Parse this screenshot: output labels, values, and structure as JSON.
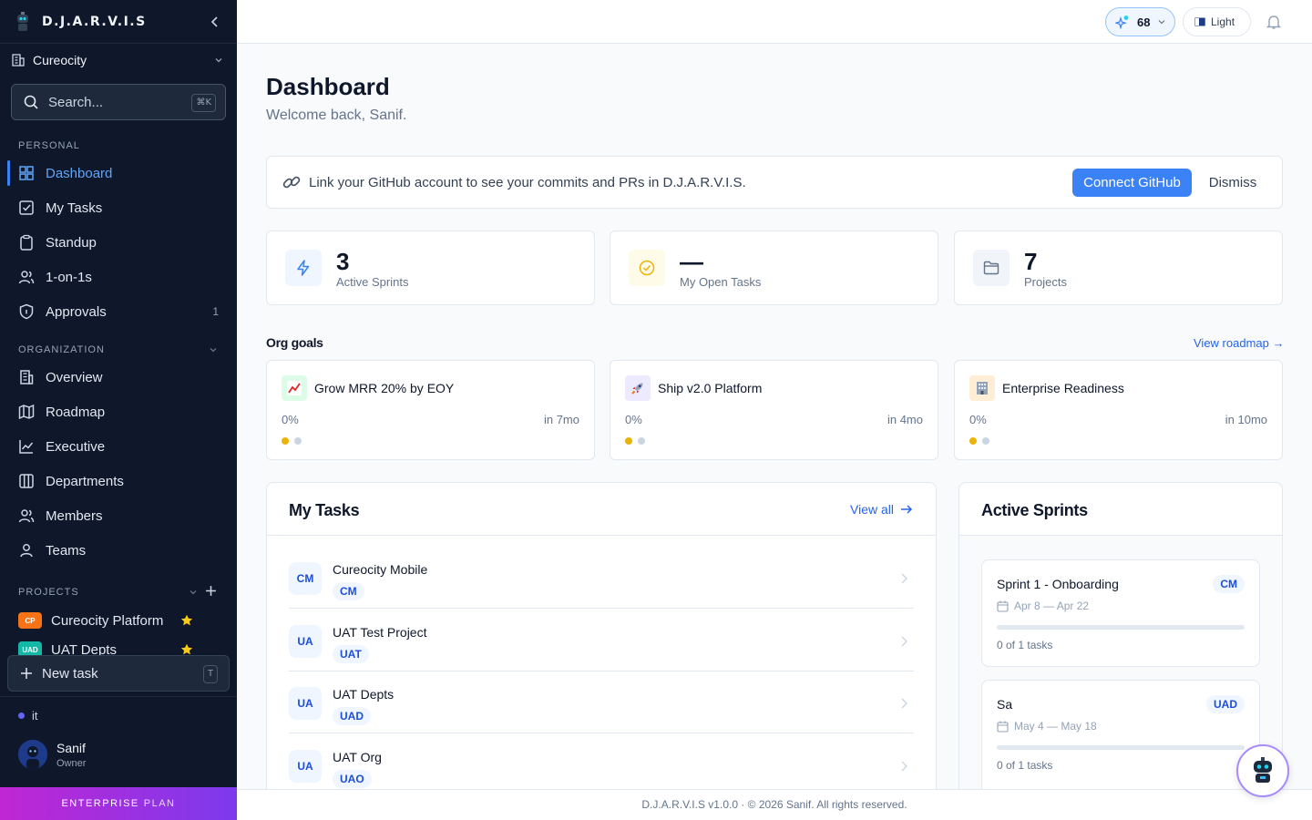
{
  "brand": {
    "name": "D.J.A.R.V.I.S"
  },
  "org": {
    "name": "Cureocity"
  },
  "search": {
    "placeholder": "Search...",
    "shortcut": "⌘K"
  },
  "sidebar": {
    "personal_label": "PERSONAL",
    "personal": [
      {
        "label": "Dashboard",
        "icon": "grid-icon",
        "active": true
      },
      {
        "label": "My Tasks",
        "icon": "checkbox-icon"
      },
      {
        "label": "Standup",
        "icon": "clipboard-icon"
      },
      {
        "label": "1-on-1s",
        "icon": "users-icon"
      },
      {
        "label": "Approvals",
        "icon": "shield-icon",
        "count": "1"
      }
    ],
    "organization_label": "ORGANIZATION",
    "organization": [
      {
        "label": "Overview",
        "icon": "building-icon"
      },
      {
        "label": "Roadmap",
        "icon": "map-icon"
      },
      {
        "label": "Executive",
        "icon": "line-chart-icon"
      },
      {
        "label": "Departments",
        "icon": "columns-icon"
      },
      {
        "label": "Members",
        "icon": "users-icon"
      },
      {
        "label": "Teams",
        "icon": "team-icon"
      }
    ],
    "projects_label": "PROJECTS",
    "projects": [
      {
        "badge": "CP",
        "label": "Cureocity Platform",
        "color": "#f97316"
      },
      {
        "badge": "UAD",
        "label": "UAT Depts",
        "color": "#14b8a6"
      }
    ],
    "new_task": {
      "label": "New task",
      "shortcut": "T"
    },
    "workspace": "it",
    "user": {
      "name": "Sanif",
      "role": "Owner"
    },
    "plan": {
      "word1": "ENTERPRISE",
      "word2": "PLAN"
    }
  },
  "topbar": {
    "ai_count": "68",
    "theme_label": "Light"
  },
  "header": {
    "title": "Dashboard",
    "subtitle": "Welcome back, Sanif."
  },
  "banner": {
    "text": "Link your GitHub account to see your commits and PRs in D.J.A.R.V.I.S.",
    "connect_label": "Connect GitHub",
    "dismiss_label": "Dismiss"
  },
  "stats": [
    {
      "value": "3",
      "label": "Active Sprints",
      "icon": "lightning-icon"
    },
    {
      "value": "—",
      "label": "My Open Tasks",
      "icon": "check-circle-icon"
    },
    {
      "value": "7",
      "label": "Projects",
      "icon": "folder-icon"
    }
  ],
  "goals": {
    "heading": "Org goals",
    "link": "View roadmap →",
    "items": [
      {
        "title": "Grow MRR 20% by EOY",
        "progress": "0%",
        "due": "in 7mo",
        "icon": "chart-up-icon"
      },
      {
        "title": "Ship v2.0 Platform",
        "progress": "0%",
        "due": "in 4mo",
        "icon": "rocket-icon"
      },
      {
        "title": "Enterprise Readiness",
        "progress": "0%",
        "due": "in 10mo",
        "icon": "office-building-icon"
      }
    ]
  },
  "my_tasks": {
    "title": "My Tasks",
    "view_all": "View all",
    "items": [
      {
        "avatar": "CM",
        "name": "Cureocity Mobile",
        "tag": "CM"
      },
      {
        "avatar": "UA",
        "name": "UAT Test Project",
        "tag": "UAT"
      },
      {
        "avatar": "UA",
        "name": "UAT Depts",
        "tag": "UAD"
      },
      {
        "avatar": "UA",
        "name": "UAT Org",
        "tag": "UAO"
      }
    ]
  },
  "active_sprints": {
    "title": "Active Sprints",
    "items": [
      {
        "name": "Sprint 1 - Onboarding",
        "tag": "CM",
        "dates": "Apr 8 — Apr 22",
        "tasks": "0 of 1 tasks",
        "progress": 0
      },
      {
        "name": "Sa",
        "tag": "UAD",
        "dates": "May 4 — May 18",
        "tasks": "0 of 1 tasks",
        "progress": 0
      }
    ]
  },
  "footer": {
    "text": "D.J.A.R.V.I.S v1.0.0 · © 2026 Sanif. All rights reserved."
  },
  "colors": {
    "sidebar": "#0f172a",
    "accent": "#3b82f6",
    "plan_from": "#c026d3",
    "plan_to": "#7c3aed"
  }
}
